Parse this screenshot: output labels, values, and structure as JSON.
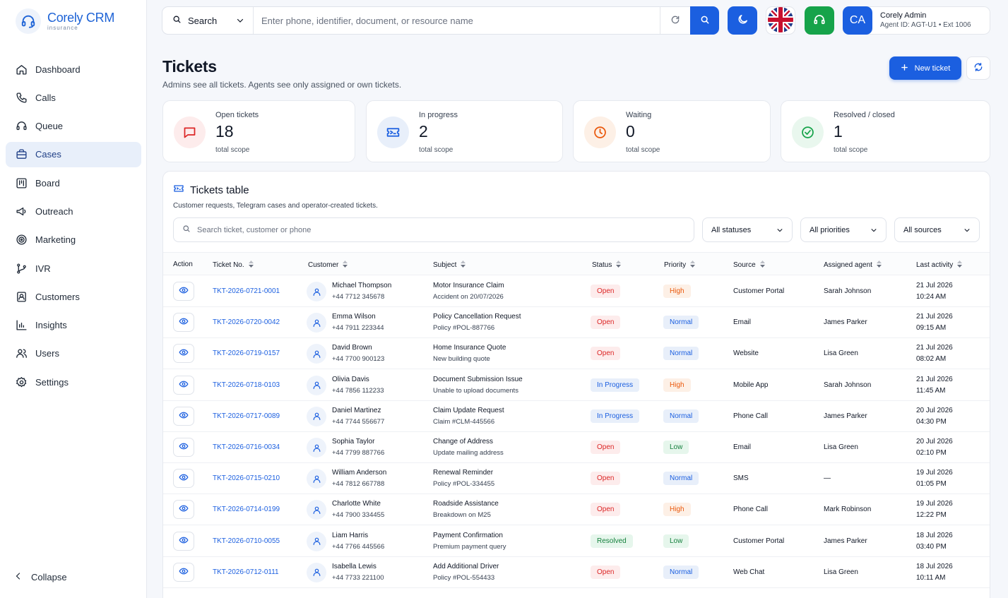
{
  "brand": {
    "name": "Corely CRM",
    "sub": "insurance"
  },
  "nav": [
    {
      "label": "Dashboard",
      "icon": "home-icon"
    },
    {
      "label": "Calls",
      "icon": "phone-icon"
    },
    {
      "label": "Queue",
      "icon": "headset-icon"
    },
    {
      "label": "Cases",
      "icon": "briefcase-icon",
      "active": true
    },
    {
      "label": "Board",
      "icon": "kanban-icon"
    },
    {
      "label": "Outreach",
      "icon": "megaphone-icon"
    },
    {
      "label": "Marketing",
      "icon": "target-icon"
    },
    {
      "label": "IVR",
      "icon": "branch-icon"
    },
    {
      "label": "Customers",
      "icon": "contact-icon"
    },
    {
      "label": "Insights",
      "icon": "bar-chart-icon"
    },
    {
      "label": "Users",
      "icon": "users-icon"
    },
    {
      "label": "Settings",
      "icon": "gear-icon"
    }
  ],
  "collapse_label": "Collapse",
  "topbar": {
    "search_type": "Search",
    "search_placeholder": "Enter phone, identifier, document, or resource name",
    "user_initials": "CA",
    "user_name": "Corely Admin",
    "user_sub": "Agent ID: AGT-U1 • Ext 1006"
  },
  "page": {
    "title": "Tickets",
    "subtitle": "Admins see all tickets. Agents see only assigned or own tickets.",
    "new_ticket": "New ticket"
  },
  "stats": [
    {
      "label": "Open tickets",
      "value": "18",
      "note": "total scope",
      "icon": "message-icon",
      "color": "#dc2626",
      "bg": "#fdecec"
    },
    {
      "label": "In progress",
      "value": "2",
      "note": "total scope",
      "icon": "ticket-icon",
      "color": "#1b5fe0",
      "bg": "#e8effa"
    },
    {
      "label": "Waiting",
      "value": "0",
      "note": "total scope",
      "icon": "clock-icon",
      "color": "#ea580c",
      "bg": "#fdf0e6"
    },
    {
      "label": "Resolved / closed",
      "value": "1",
      "note": "total scope",
      "icon": "check-circle-icon",
      "color": "#16a34a",
      "bg": "#e9f7ee"
    }
  ],
  "table": {
    "title": "Tickets table",
    "subtitle": "Customer requests, Telegram cases and operator-created tickets.",
    "search_placeholder": "Search ticket, customer or phone",
    "filters": [
      "All statuses",
      "All priorities",
      "All sources"
    ],
    "columns": [
      "Action",
      "Ticket No.",
      "Customer",
      "Subject",
      "Status",
      "Priority",
      "Source",
      "Assigned agent",
      "Last activity"
    ],
    "rows": [
      {
        "id": "TKT-2026-0721-0001",
        "name": "Michael Thompson",
        "phone": "+44 7712 345678",
        "subject": "Motor Insurance Claim",
        "detail": "Accident on 20/07/2026",
        "status": "Open",
        "priority": "High",
        "source": "Customer Portal",
        "agent": "Sarah Johnson",
        "date": "21 Jul 2026",
        "time": "10:24 AM"
      },
      {
        "id": "TKT-2026-0720-0042",
        "name": "Emma Wilson",
        "phone": "+44 7911 223344",
        "subject": "Policy Cancellation Request",
        "detail": "Policy #POL-887766",
        "status": "Open",
        "priority": "Normal",
        "source": "Email",
        "agent": "James Parker",
        "date": "21 Jul 2026",
        "time": "09:15 AM"
      },
      {
        "id": "TKT-2026-0719-0157",
        "name": "David Brown",
        "phone": "+44 7700 900123",
        "subject": "Home Insurance Quote",
        "detail": "New building quote",
        "status": "Open",
        "priority": "Normal",
        "source": "Website",
        "agent": "Lisa Green",
        "date": "21 Jul 2026",
        "time": "08:02 AM"
      },
      {
        "id": "TKT-2026-0718-0103",
        "name": "Olivia Davis",
        "phone": "+44 7856 112233",
        "subject": "Document Submission Issue",
        "detail": "Unable to upload documents",
        "status": "In Progress",
        "priority": "High",
        "source": "Mobile App",
        "agent": "Sarah Johnson",
        "date": "21 Jul 2026",
        "time": "11:45 AM"
      },
      {
        "id": "TKT-2026-0717-0089",
        "name": "Daniel Martinez",
        "phone": "+44 7744 556677",
        "subject": "Claim Update Request",
        "detail": "Claim #CLM-445566",
        "status": "In Progress",
        "priority": "Normal",
        "source": "Phone Call",
        "agent": "James Parker",
        "date": "20 Jul 2026",
        "time": "04:30 PM"
      },
      {
        "id": "TKT-2026-0716-0034",
        "name": "Sophia Taylor",
        "phone": "+44 7799 887766",
        "subject": "Change of Address",
        "detail": "Update mailing address",
        "status": "Open",
        "priority": "Low",
        "source": "Email",
        "agent": "Lisa Green",
        "date": "20 Jul 2026",
        "time": "02:10 PM"
      },
      {
        "id": "TKT-2026-0715-0210",
        "name": "William Anderson",
        "phone": "+44 7812 667788",
        "subject": "Renewal Reminder",
        "detail": "Policy #POL-334455",
        "status": "Open",
        "priority": "Normal",
        "source": "SMS",
        "agent": "—",
        "date": "19 Jul 2026",
        "time": "01:05 PM"
      },
      {
        "id": "TKT-2026-0714-0199",
        "name": "Charlotte White",
        "phone": "+44 7900 334455",
        "subject": "Roadside Assistance",
        "detail": "Breakdown on M25",
        "status": "Open",
        "priority": "High",
        "source": "Phone Call",
        "agent": "Mark Robinson",
        "date": "19 Jul 2026",
        "time": "12:22 PM"
      },
      {
        "id": "TKT-2026-0710-0055",
        "name": "Liam Harris",
        "phone": "+44 7766 445566",
        "subject": "Payment Confirmation",
        "detail": "Premium payment query",
        "status": "Resolved",
        "priority": "Low",
        "source": "Customer Portal",
        "agent": "James Parker",
        "date": "18 Jul 2026",
        "time": "03:40 PM"
      },
      {
        "id": "TKT-2026-0712-0111",
        "name": "Isabella Lewis",
        "phone": "+44 7733 221100",
        "subject": "Add Additional Driver",
        "detail": "Policy #POL-554433",
        "status": "Open",
        "priority": "Normal",
        "source": "Web Chat",
        "agent": "Lisa Green",
        "date": "18 Jul 2026",
        "time": "10:11 AM"
      }
    ]
  },
  "colors": {
    "accent": "#1b5fe0",
    "open": "#dc2626",
    "open_bg": "#fdecec",
    "progress": "#1b5fe0",
    "progress_bg": "#e8effa",
    "resolved": "#15803d",
    "resolved_bg": "#e6f6ec",
    "high": "#ea580c",
    "high_bg": "#fdf0e6",
    "normal": "#1b5fe0",
    "normal_bg": "#e8effa",
    "low": "#15803d",
    "low_bg": "#e6f6ec"
  }
}
